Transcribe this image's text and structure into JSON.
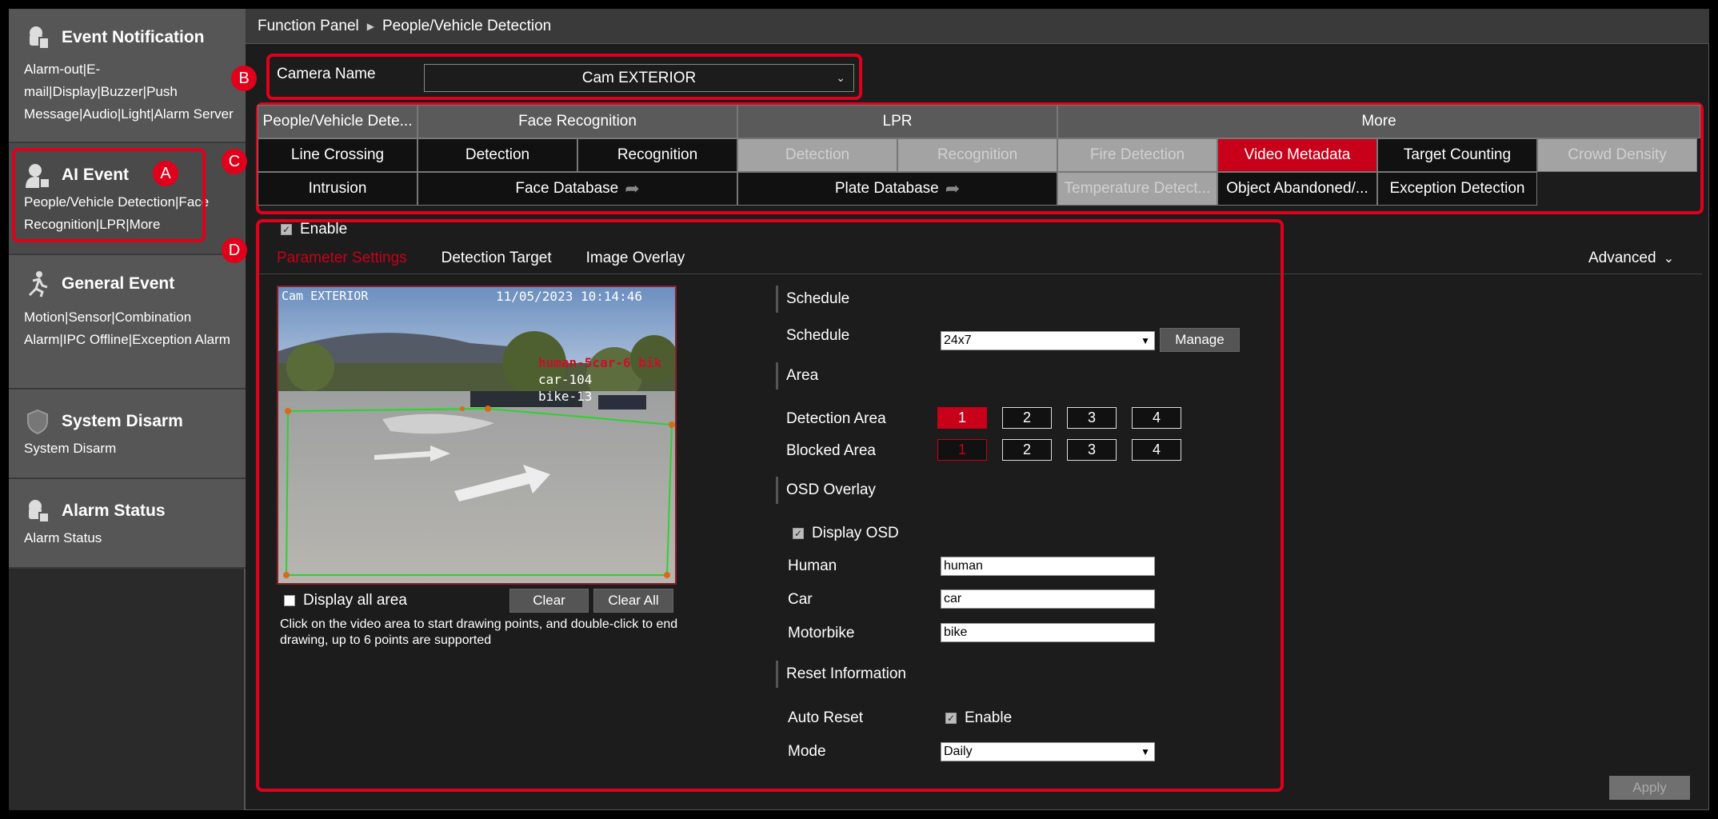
{
  "sidebar": {
    "sections": [
      {
        "title": "Event Notification",
        "desc": "Alarm-out|E-mail|Display|Buzzer|Push Message|Audio|Light|Alarm Server",
        "icon": "bell-icon"
      },
      {
        "title": "AI Event",
        "desc": "People/Vehicle Detection|Face Recognition|LPR|More",
        "icon": "ai-person-icon"
      },
      {
        "title": "General Event",
        "desc": "Motion|Sensor|Combination Alarm|IPC Offline|Exception Alarm",
        "icon": "running-person-icon"
      },
      {
        "title": "System Disarm",
        "desc": "System Disarm",
        "icon": "shield-icon"
      },
      {
        "title": "Alarm Status",
        "desc": "Alarm Status",
        "icon": "alarm-status-icon"
      }
    ]
  },
  "breadcrumb": {
    "root": "Function Panel",
    "current": "People/Vehicle Detection"
  },
  "markers": {
    "a": "A",
    "b": "B",
    "c": "C",
    "d": "D"
  },
  "camera": {
    "label": "Camera Name",
    "value": "Cam EXTERIOR"
  },
  "function_grid": {
    "heads": [
      "People/Vehicle Dete...",
      "Face Recognition",
      "LPR",
      "More"
    ],
    "row1": [
      "Line Crossing",
      "Detection",
      "Recognition",
      "Detection",
      "Recognition",
      "Fire Detection",
      "Video Metadata",
      "Target Counting",
      "Crowd Density"
    ],
    "row2": [
      "Intrusion",
      "Face Database",
      "Plate Database",
      "Temperature Detect...",
      "Object Abandoned/...",
      "Exception Detection"
    ]
  },
  "enable_label": "Enable",
  "tabs": [
    "Parameter Settings",
    "Detection Target",
    "Image Overlay"
  ],
  "advanced_label": "Advanced",
  "video": {
    "osd_name": "Cam EXTERIOR",
    "osd_time": "11/05/2023 10:14:46",
    "overlay_red": "human-5car-6 bik",
    "overlay_car": "car-104",
    "overlay_bike": "bike-13"
  },
  "display_all_label": "Display all area",
  "clear_label": "Clear",
  "clear_all_label": "Clear All",
  "hint": "Click on the video area to start drawing points, and double-click to end drawing, up to 6 points are supported",
  "schedule": {
    "section": "Schedule",
    "label": "Schedule",
    "value": "24x7",
    "manage": "Manage"
  },
  "area": {
    "section": "Area",
    "detection_label": "Detection Area",
    "blocked_label": "Blocked Area",
    "numbers": [
      "1",
      "2",
      "3",
      "4"
    ]
  },
  "osd": {
    "section": "OSD Overlay",
    "display_label": "Display OSD",
    "human_label": "Human",
    "human_value": "human",
    "car_label": "Car",
    "car_value": "car",
    "motorbike_label": "Motorbike",
    "motorbike_value": "bike"
  },
  "reset": {
    "section": "Reset Information",
    "auto_label": "Auto Reset",
    "auto_enable": "Enable",
    "mode_label": "Mode",
    "mode_value": "Daily"
  },
  "apply_label": "Apply",
  "colors": {
    "accent": "#c8001a",
    "annotation": "#e1001c",
    "bg": "#1c1c1c"
  }
}
